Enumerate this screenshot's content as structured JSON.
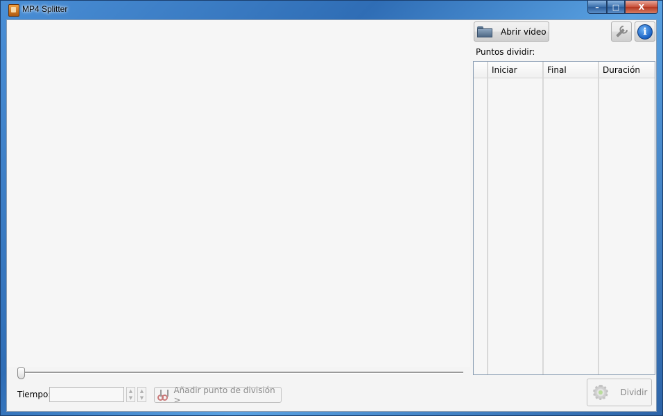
{
  "window": {
    "title": "MP4 Splitter",
    "controls": {
      "minimize": "–",
      "maximize": "□",
      "close": "X"
    }
  },
  "toolbar": {
    "open_label": "Abrir vídeo",
    "settings_icon": "wrench-icon",
    "info_icon": "info-icon",
    "info_glyph": "i"
  },
  "split_points": {
    "label": "Puntos dividir:",
    "columns": [
      "",
      "Iniciar",
      "Final",
      "Duración"
    ],
    "rows": []
  },
  "player": {
    "position": 0,
    "time_label": "Tiempo:",
    "time_value": "",
    "add_label": "Añadir punto de división >"
  },
  "actions": {
    "divide_label": "Dividir"
  }
}
